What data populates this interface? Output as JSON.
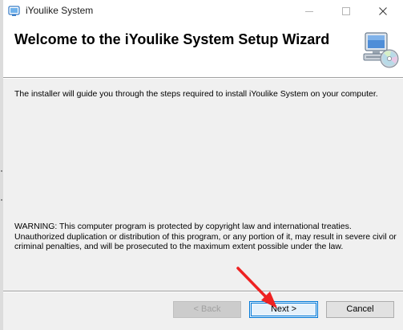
{
  "window": {
    "title": "iYoulike System"
  },
  "banner": {
    "title": "Welcome to the iYoulike System Setup Wizard",
    "icon": "setup-computer-cd-icon"
  },
  "content": {
    "intro": "The installer will guide you through the steps required to install iYoulike System on your computer.",
    "warning": "WARNING: This computer program is protected by copyright law and international treaties. Unauthorized duplication or distribution of this program, or any portion of it, may result in severe civil or criminal penalties, and will be prosecuted to the maximum extent possible under the law."
  },
  "buttons": {
    "back": "< Back",
    "next": "Next >",
    "cancel": "Cancel"
  },
  "annotation": {
    "arrow_color": "#ee2222"
  },
  "colors": {
    "accent": "#0078d7"
  }
}
